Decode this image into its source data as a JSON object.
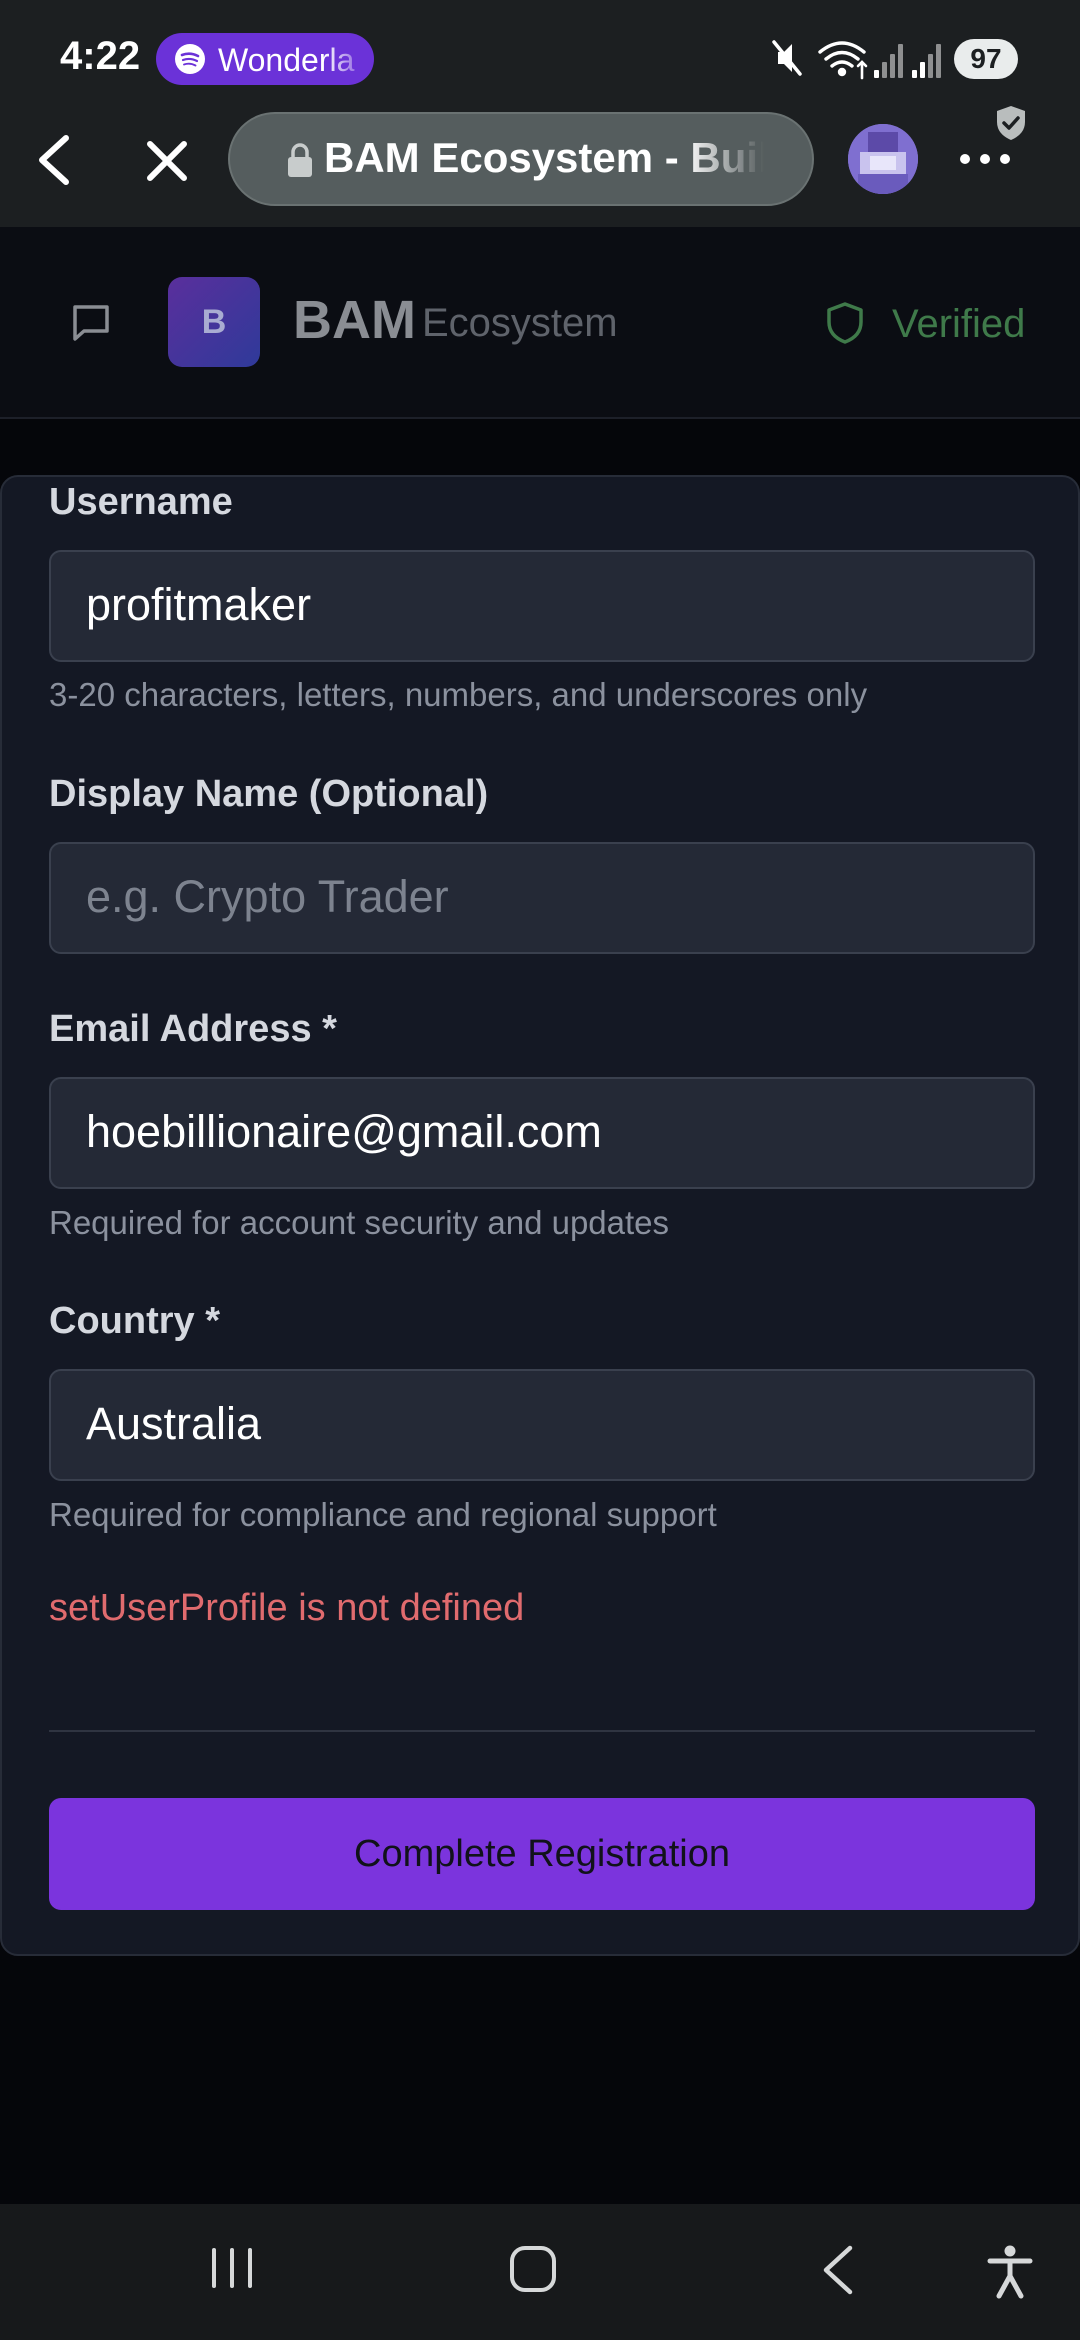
{
  "status_bar": {
    "time": "4:22",
    "media_app": "Wonderla",
    "battery": "97",
    "icons": [
      "mute-icon",
      "wifi-icon",
      "signal-icon",
      "signal-icon"
    ]
  },
  "browser": {
    "url_title": "BAM Ecosystem - Build",
    "icons": [
      "back-icon",
      "close-icon",
      "lock-icon",
      "avatar",
      "menu-icon",
      "shield-badge-icon"
    ]
  },
  "app_header": {
    "logo_letter": "B",
    "brand_primary": "BAM",
    "brand_secondary": "Ecosystem",
    "verified_label": "Verified"
  },
  "form": {
    "username": {
      "label": "Username",
      "value": "profitmaker",
      "hint": "3-20 characters, letters, numbers, and underscores only"
    },
    "display_name": {
      "label": "Display Name (Optional)",
      "placeholder": "e.g. Crypto Trader"
    },
    "email": {
      "label": "Email Address *",
      "value": "hoebillionaire@gmail.com",
      "hint": "Required for account security and updates"
    },
    "country": {
      "label": "Country *",
      "value": "Australia",
      "hint": "Required for compliance and regional support"
    },
    "error": "setUserProfile is not defined",
    "submit_label": "Complete Registration"
  },
  "colors": {
    "accent": "#7b34dd",
    "error": "#e06b6e",
    "verified": "#3f7a4a",
    "card_bg": "#141824"
  }
}
